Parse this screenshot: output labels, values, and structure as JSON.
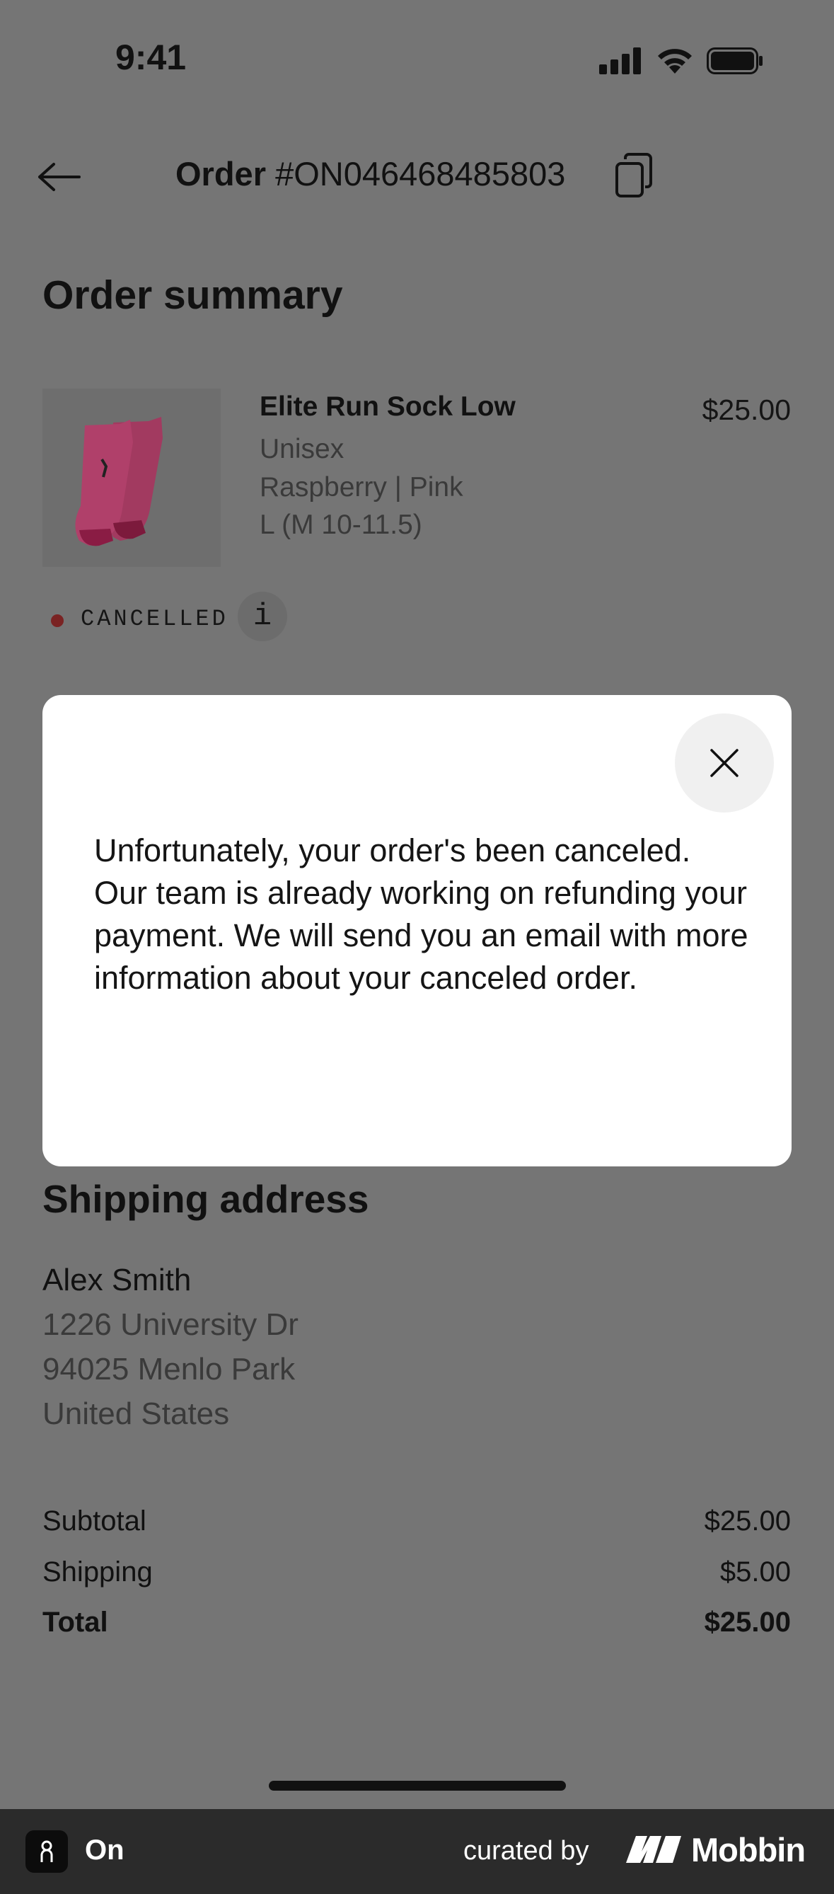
{
  "status_bar": {
    "time": "9:41"
  },
  "header": {
    "order_label": "Order",
    "order_number": "#ON046468485803"
  },
  "summary": {
    "title": "Order summary",
    "product": {
      "name": "Elite Run Sock Low",
      "price": "$25.00",
      "gender": "Unisex",
      "color": "Raspberry | Pink",
      "size": "L (M 10-11.5)"
    },
    "status": {
      "label": "CANCELLED",
      "info_icon": "i"
    }
  },
  "modal": {
    "message": "Unfortunately, your order's been canceled. Our team is already working on refunding your payment. We will send you an email with more information about your canceled order."
  },
  "shipping": {
    "title": "Shipping address",
    "name": "Alex Smith",
    "street": "1226 University Dr",
    "city": "94025 Menlo Park",
    "country": "United States"
  },
  "totals": {
    "subtotal_label": "Subtotal",
    "subtotal_value": "$25.00",
    "shipping_label": "Shipping",
    "shipping_value": "$5.00",
    "total_label": "Total",
    "total_value": "$25.00"
  },
  "footer": {
    "app_name": "On",
    "curated_by": "curated by",
    "brand": "Mobbin"
  },
  "colors": {
    "overlay_bg": "#757575",
    "status_dot": "#7a2323",
    "sock_pink": "#b0406a"
  }
}
